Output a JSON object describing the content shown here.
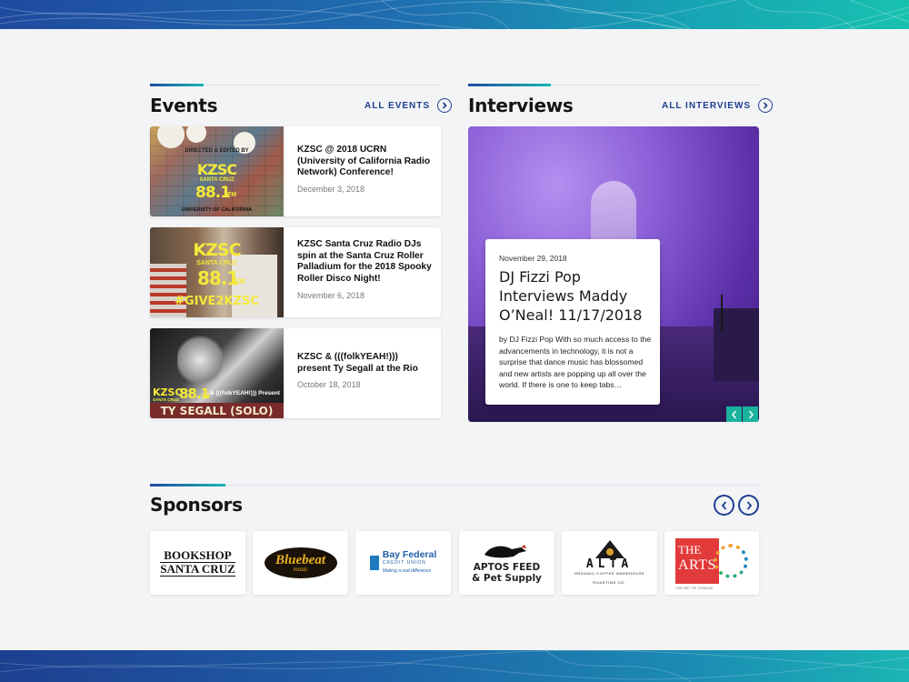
{
  "events": {
    "heading": "Events",
    "all_link": "ALL EVENTS",
    "items": [
      {
        "title": "KZSC @ 2018 UCRN (University of California Radio Network) Conference!",
        "date": "December 3, 2018",
        "thumb": {
          "small": "DIRECTED & EDITED BY",
          "brand": "KZSC",
          "sub": "SANTA CRUZ",
          "freq": "88.1",
          "unit": "FM",
          "footer": "UNIVERSITY OF CALIFORNIA"
        }
      },
      {
        "title": "KZSC Santa Cruz Radio DJs spin at the Santa Cruz Roller Palladium for the 2018 Spooky Roller Disco Night!",
        "date": "November 6, 2018",
        "thumb": {
          "brand": "KZSC",
          "sub": "SANTA CRUZ",
          "freq": "88.1",
          "unit": "FM",
          "tag": "#GIVE2KZSC"
        }
      },
      {
        "title": "KZSC & (((folkYEAH!))) present Ty Segall at the Rio",
        "date": "October 18, 2018",
        "thumb": {
          "brand": "KZSC",
          "sub": "SANTA CRUZ",
          "freq": "88.1",
          "unit": "FM",
          "present": "& (((folkYEAH!))) Present",
          "artist": "TY SEGALL (SOLO)"
        }
      }
    ]
  },
  "interviews": {
    "heading": "Interviews",
    "all_link": "ALL INTERVIEWS",
    "featured": {
      "date": "November 29, 2018",
      "title": "DJ Fizzi Pop Interviews Maddy O’Neal! 11/17/2018",
      "excerpt": "by DJ Fizzi Pop With so much access to the advancements in technology, it is not a surprise that dance music has blossomed and new artists are popping up all over the world. If there is one to keep tabs…"
    }
  },
  "sponsors": {
    "heading": "Sponsors",
    "logos": [
      {
        "name": "Bookshop Santa Cruz",
        "line1": "BOOKSHOP",
        "line2": "SANTA CRUZ"
      },
      {
        "name": "Bluebeat Music",
        "line1": "Bluebeat",
        "line2": "music"
      },
      {
        "name": "Bay Federal Credit Union",
        "line1": "Bay Federal",
        "line2": "CREDIT UNION",
        "line3": "Making a real difference"
      },
      {
        "name": "Aptos Feed & Pet Supply",
        "line1": "APTOS FEED",
        "line2": "& Pet Supply"
      },
      {
        "name": "Alta Organic Coffee",
        "line1": "ALTA",
        "line2": "ORGANIC COFFEE WAREHOUSE",
        "line3": "ROASTING CO."
      },
      {
        "name": "The Arts",
        "line1": "THE",
        "line2": "ARTS",
        "line3": "THE ART OF CHANGE"
      }
    ]
  },
  "colors": {
    "accent_navy": "#1d3f8f",
    "accent_teal": "#1ab7b0",
    "slider_button": "#1ab39e"
  }
}
